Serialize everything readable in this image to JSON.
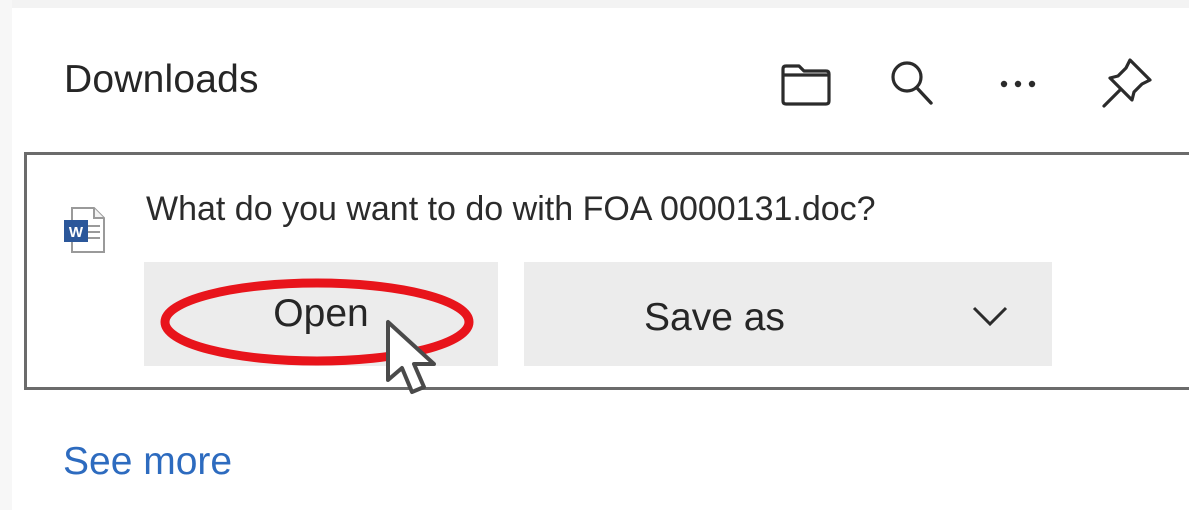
{
  "panel": {
    "title": "Downloads"
  },
  "header_actions": [
    {
      "icon": "folder-icon",
      "label": "Open downloads folder"
    },
    {
      "icon": "search-icon",
      "label": "Search downloads"
    },
    {
      "icon": "more-options-icon",
      "label": "More options"
    },
    {
      "icon": "pin-icon",
      "label": "Pin downloads"
    }
  ],
  "download_item": {
    "file_icon": "word-document-icon",
    "prompt": "What do you want to do with FOA 0000131.doc?",
    "open_label": "Open",
    "save_as_label": "Save as",
    "save_as_dropdown_icon": "chevron-down-icon"
  },
  "footer": {
    "see_more_label": "See more"
  },
  "colors": {
    "highlight_ring": "#e8141b",
    "link": "#2d6bbf",
    "button_bg": "#ececec",
    "card_border": "#6b6b6b",
    "word_blue": "#2b579a"
  }
}
